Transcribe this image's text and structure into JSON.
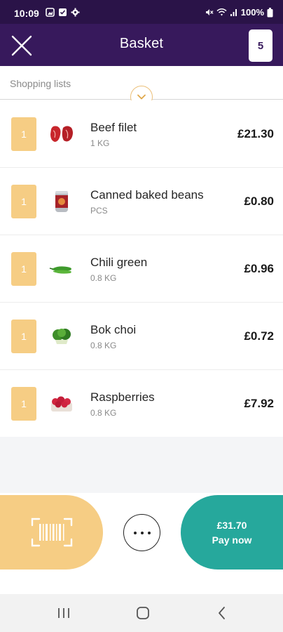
{
  "status_bar": {
    "time": "10:09",
    "battery_text": "100%",
    "icons_left": [
      "image-icon",
      "check-square-icon",
      "gear-icon"
    ],
    "icons_right": [
      "mute-icon",
      "wifi-icon",
      "signal-icon",
      "battery-icon"
    ]
  },
  "header": {
    "title": "Basket",
    "basket_count": "5",
    "close_icon": "close-icon"
  },
  "shopping_lists": {
    "label": "Shopping lists",
    "expand_icon": "chevron-down-icon"
  },
  "items": [
    {
      "qty": "1",
      "name": "Beef filet",
      "unit": "1 KG",
      "price": "£21.30",
      "icon": "beef-icon"
    },
    {
      "qty": "1",
      "name": "Canned baked beans",
      "unit": "PCS",
      "price": "£0.80",
      "icon": "can-icon"
    },
    {
      "qty": "1",
      "name": "Chili green",
      "unit": "0.8 KG",
      "price": "£0.96",
      "icon": "chili-icon"
    },
    {
      "qty": "1",
      "name": "Bok choi",
      "unit": "0.8 KG",
      "price": "£0.72",
      "icon": "bok-choi-icon"
    },
    {
      "qty": "1",
      "name": "Raspberries",
      "unit": "0.8 KG",
      "price": "£7.92",
      "icon": "raspberries-icon"
    }
  ],
  "actions": {
    "scan_icon": "barcode-scan-icon",
    "more_icon": "more-icon",
    "pay_amount": "£31.70",
    "pay_label": "Pay now"
  },
  "nav": {
    "recents_icon": "recents-icon",
    "home_icon": "home-icon",
    "back_icon": "back-icon"
  },
  "colors": {
    "header": "#37195c",
    "status_bar": "#2a1348",
    "accent_yellow": "#f6cd84",
    "pay_teal": "#26a89c"
  }
}
